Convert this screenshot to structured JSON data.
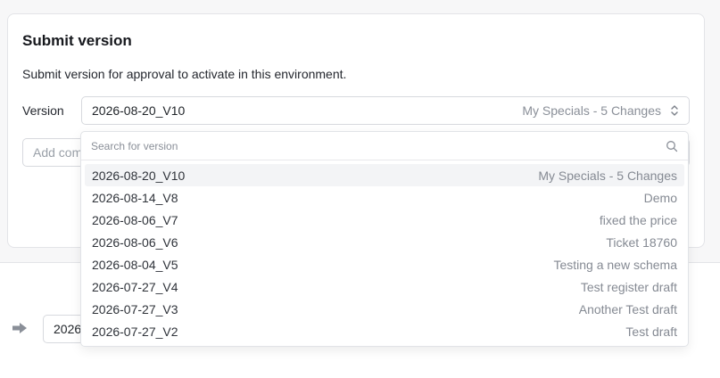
{
  "card": {
    "title": "Submit version",
    "description": "Submit version for approval to activate in this environment.",
    "version_label": "Version",
    "selected_version": "2026-08-20_V10",
    "selected_description": "My Specials - 5 Changes",
    "comment_placeholder": "Add com"
  },
  "second_card": {
    "select_value": "2026"
  },
  "dropdown": {
    "search_placeholder": "Search for version",
    "options": [
      {
        "name": "2026-08-20_V10",
        "desc": "My Specials - 5 Changes",
        "selected": true
      },
      {
        "name": "2026-08-14_V8",
        "desc": "Demo"
      },
      {
        "name": "2026-08-06_V7",
        "desc": "fixed the price"
      },
      {
        "name": "2026-08-06_V6",
        "desc": "Ticket 18760"
      },
      {
        "name": "2026-08-04_V5",
        "desc": "Testing a new schema"
      },
      {
        "name": "2026-07-27_V4",
        "desc": "Test register draft"
      },
      {
        "name": "2026-07-27_V3",
        "desc": "Another Test draft"
      },
      {
        "name": "2026-07-27_V2",
        "desc": "Test draft"
      }
    ]
  },
  "icons": {
    "chevron": "chevron-updown-icon",
    "search": "search-icon",
    "arrow": "arrow-right-icon"
  }
}
